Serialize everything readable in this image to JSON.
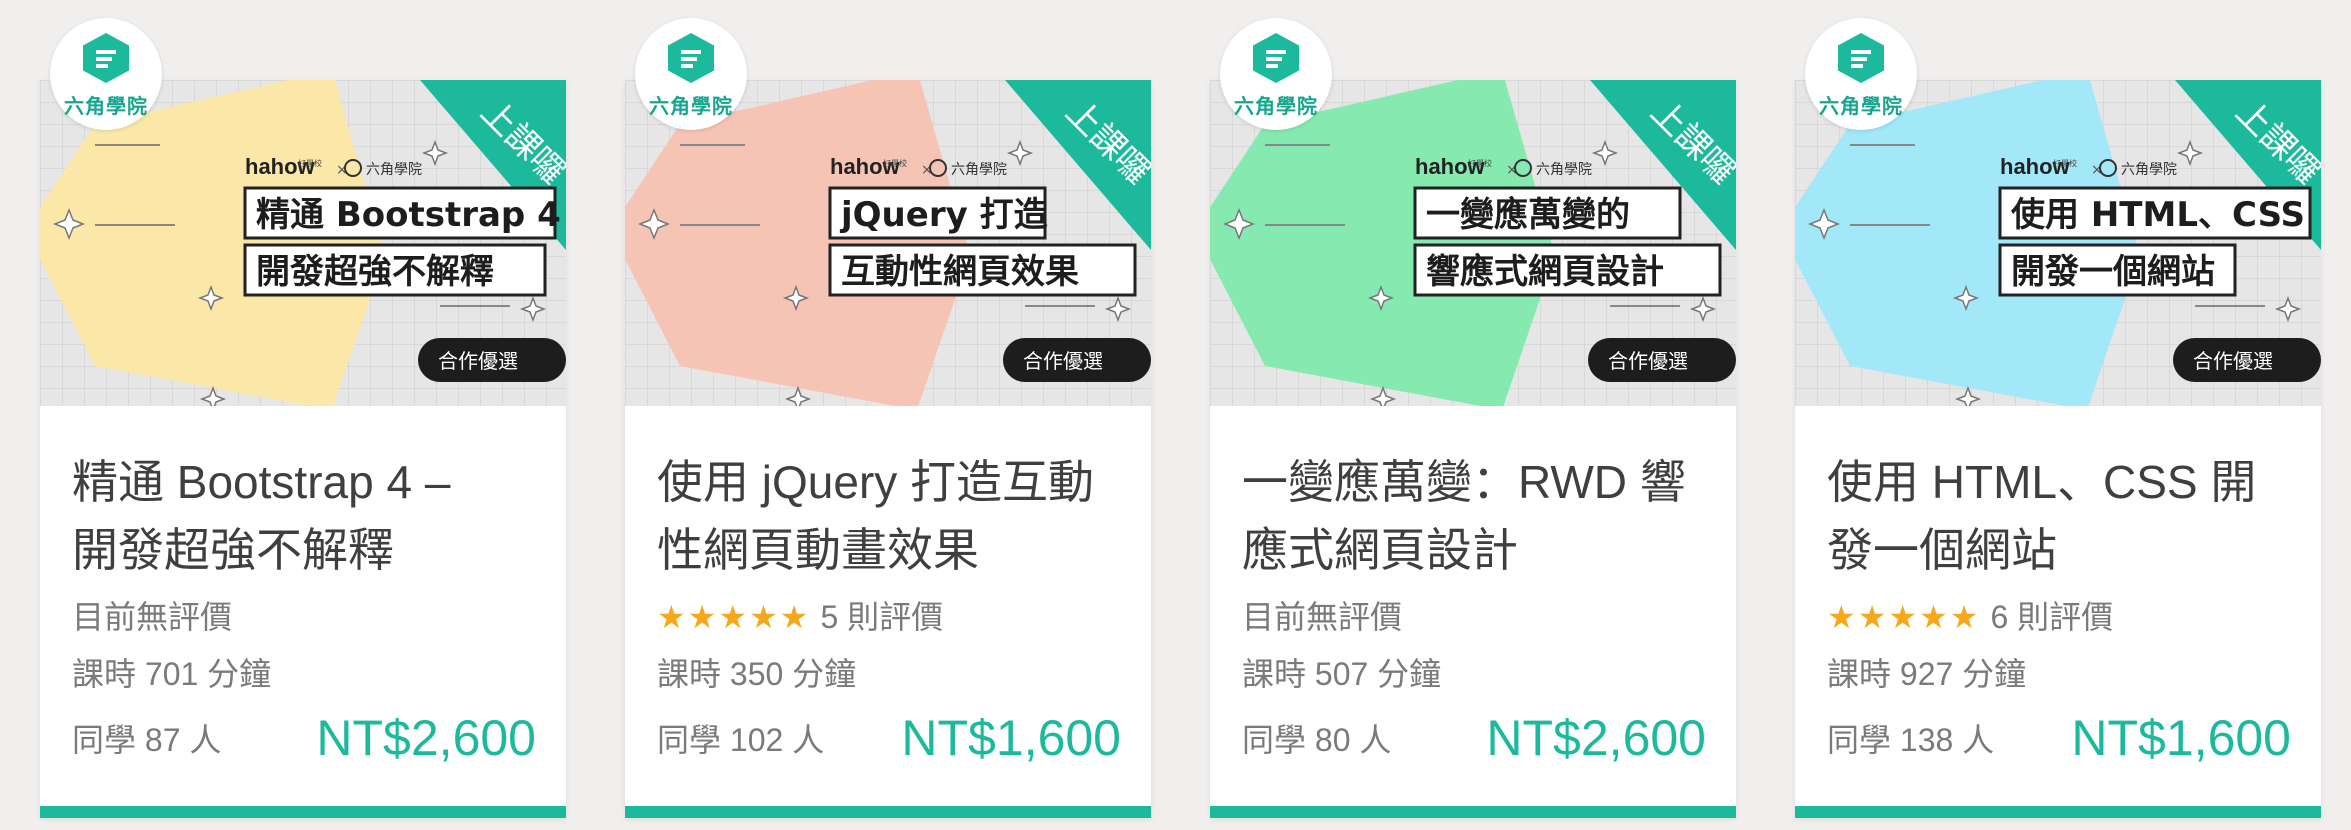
{
  "brand": {
    "logo_text": "六角學院",
    "accent_color": "#1db99d",
    "ribbon_text": "上課囉",
    "partner_name": "hahow",
    "partner_small": "好學校",
    "school_small": "六角學院",
    "collab_badge": "合作優選"
  },
  "courses": [
    {
      "thumb_bg": "#fbe8a8",
      "banner_line1": "精通 Bootstrap 4",
      "banner_line2": "開發超強不解釋",
      "title_line1": "精通 Bootstrap 4 –",
      "title_line2": "開發超強不解釋",
      "rating_stars": "",
      "rating_text": "目前無評價",
      "duration": "課時 701 分鐘",
      "students": "同學 87 人",
      "price": "NT$2,600"
    },
    {
      "thumb_bg": "#f5c4b4",
      "banner_line1": "jQuery 打造",
      "banner_line2": "互動性網頁效果",
      "title_line1": "使用 jQuery 打造互動",
      "title_line2": "性網頁動畫效果",
      "rating_stars": "★★★★★",
      "rating_text": "5 則評價",
      "duration": "課時 350 分鐘",
      "students": "同學 102 人",
      "price": "NT$1,600"
    },
    {
      "thumb_bg": "#86eab0",
      "banner_line1": "一變應萬變的",
      "banner_line2": "響應式網頁設計",
      "title_line1": "一變應萬變：RWD 響",
      "title_line2": "應式網頁設計",
      "rating_stars": "",
      "rating_text": "目前無評價",
      "duration": "課時 507 分鐘",
      "students": "同學 80 人",
      "price": "NT$2,600"
    },
    {
      "thumb_bg": "#a2e8f8",
      "banner_line1": "使用 HTML、CSS",
      "banner_line2": "開發一個網站",
      "title_line1": "使用 HTML、CSS 開",
      "title_line2": "發一個網站",
      "rating_stars": "★★★★★",
      "rating_text": "6 則評價",
      "duration": "課時 927 分鐘",
      "students": "同學 138 人",
      "price": "NT$1,600"
    }
  ]
}
